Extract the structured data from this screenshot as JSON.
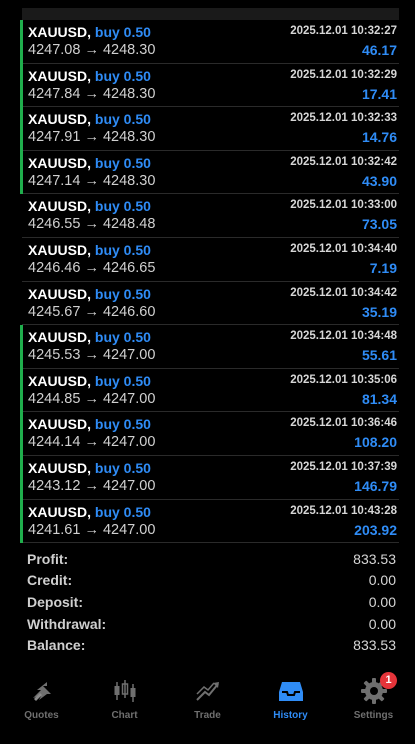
{
  "deals": [
    {
      "symbol": "XAUUSD,",
      "direction": "buy 0.50",
      "time": "2025.12.01 10:32:27",
      "prices": "4247.08 → 4248.30",
      "profit": "46.17",
      "marked": true
    },
    {
      "symbol": "XAUUSD,",
      "direction": "buy 0.50",
      "time": "2025.12.01 10:32:29",
      "prices": "4247.84 → 4248.30",
      "profit": "17.41",
      "marked": true
    },
    {
      "symbol": "XAUUSD,",
      "direction": "buy 0.50",
      "time": "2025.12.01 10:32:33",
      "prices": "4247.91 → 4248.30",
      "profit": "14.76",
      "marked": true
    },
    {
      "symbol": "XAUUSD,",
      "direction": "buy 0.50",
      "time": "2025.12.01 10:32:42",
      "prices": "4247.14 → 4248.30",
      "profit": "43.90",
      "marked": true
    },
    {
      "symbol": "XAUUSD,",
      "direction": "buy 0.50",
      "time": "2025.12.01 10:33:00",
      "prices": "4246.55 → 4248.48",
      "profit": "73.05",
      "marked": false
    },
    {
      "symbol": "XAUUSD,",
      "direction": "buy 0.50",
      "time": "2025.12.01 10:34:40",
      "prices": "4246.46 → 4246.65",
      "profit": "7.19",
      "marked": false
    },
    {
      "symbol": "XAUUSD,",
      "direction": "buy 0.50",
      "time": "2025.12.01 10:34:42",
      "prices": "4245.67 → 4246.60",
      "profit": "35.19",
      "marked": false
    },
    {
      "symbol": "XAUUSD,",
      "direction": "buy 0.50",
      "time": "2025.12.01 10:34:48",
      "prices": "4245.53 → 4247.00",
      "profit": "55.61",
      "marked": true
    },
    {
      "symbol": "XAUUSD,",
      "direction": "buy 0.50",
      "time": "2025.12.01 10:35:06",
      "prices": "4244.85 → 4247.00",
      "profit": "81.34",
      "marked": true
    },
    {
      "symbol": "XAUUSD,",
      "direction": "buy 0.50",
      "time": "2025.12.01 10:36:46",
      "prices": "4244.14 → 4247.00",
      "profit": "108.20",
      "marked": true
    },
    {
      "symbol": "XAUUSD,",
      "direction": "buy 0.50",
      "time": "2025.12.01 10:37:39",
      "prices": "4243.12 → 4247.00",
      "profit": "146.79",
      "marked": true
    },
    {
      "symbol": "XAUUSD,",
      "direction": "buy 0.50",
      "time": "2025.12.01 10:43:28",
      "prices": "4241.61 → 4247.00",
      "profit": "203.92",
      "marked": true
    }
  ],
  "summary": [
    {
      "label": "Profit:",
      "value": "833.53"
    },
    {
      "label": "Credit:",
      "value": "0.00"
    },
    {
      "label": "Deposit:",
      "value": "0.00"
    },
    {
      "label": "Withdrawal:",
      "value": "0.00"
    },
    {
      "label": "Balance:",
      "value": "833.53"
    }
  ],
  "tabs": [
    {
      "label": "Quotes",
      "icon": "quotes-icon",
      "active": false
    },
    {
      "label": "Chart",
      "icon": "candlestick-chart-icon",
      "active": false
    },
    {
      "label": "Trade",
      "icon": "trade-icon",
      "active": false
    },
    {
      "label": "History",
      "icon": "history-inbox-icon",
      "active": true
    },
    {
      "label": "Settings",
      "icon": "gear-icon",
      "active": false,
      "badge": "1"
    }
  ],
  "colors": {
    "background": "#000000",
    "accent_blue": "#2f8cf6",
    "marker_green": "#1fae4c",
    "inactive_gray": "#6f6f6f",
    "badge_red": "#e5343a"
  }
}
